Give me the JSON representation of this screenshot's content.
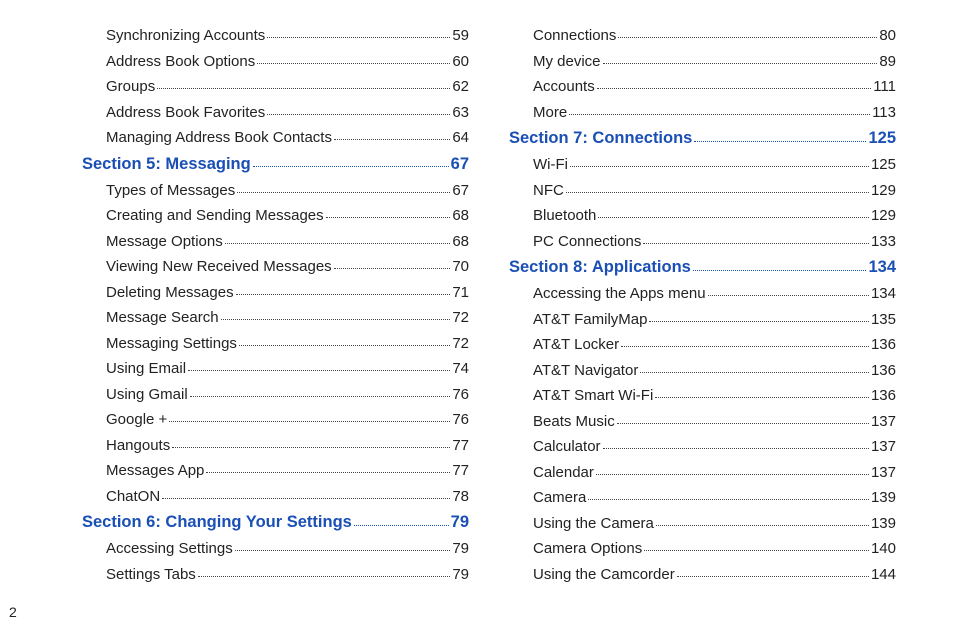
{
  "page_number": "2",
  "columns": [
    [
      {
        "type": "sub",
        "label": "Synchronizing Accounts ",
        "page": "59"
      },
      {
        "type": "sub",
        "label": "Address Book Options",
        "page": "60"
      },
      {
        "type": "sub",
        "label": "Groups ",
        "page": "62"
      },
      {
        "type": "sub",
        "label": "Address Book Favorites",
        "page": "63"
      },
      {
        "type": "sub",
        "label": "Managing Address Book Contacts",
        "page": "64"
      },
      {
        "type": "section",
        "label": "Section 5:  Messaging ",
        "page": "67"
      },
      {
        "type": "sub",
        "label": "Types of Messages",
        "page": "67"
      },
      {
        "type": "sub",
        "label": "Creating and Sending Messages",
        "page": "68"
      },
      {
        "type": "sub",
        "label": "Message Options",
        "page": "68"
      },
      {
        "type": "sub",
        "label": "Viewing New Received Messages",
        "page": "70"
      },
      {
        "type": "sub",
        "label": "Deleting Messages ",
        "page": "71"
      },
      {
        "type": "sub",
        "label": "Message Search",
        "page": "72"
      },
      {
        "type": "sub",
        "label": "Messaging Settings",
        "page": "72"
      },
      {
        "type": "sub",
        "label": "Using Email",
        "page": "74"
      },
      {
        "type": "sub",
        "label": "Using Gmail",
        "page": "76"
      },
      {
        "type": "sub",
        "label": "Google +",
        "page": "76"
      },
      {
        "type": "sub",
        "label": "Hangouts",
        "page": "77"
      },
      {
        "type": "sub",
        "label": "Messages App",
        "page": "77"
      },
      {
        "type": "sub",
        "label": "ChatON",
        "page": "78"
      },
      {
        "type": "section",
        "label": "Section 6:  Changing Your Settings ",
        "page": "79"
      },
      {
        "type": "sub",
        "label": "Accessing Settings",
        "page": "79"
      },
      {
        "type": "sub",
        "label": "Settings Tabs ",
        "page": "79"
      }
    ],
    [
      {
        "type": "sub",
        "label": "Connections ",
        "page": "80"
      },
      {
        "type": "sub",
        "label": "My device",
        "page": "89"
      },
      {
        "type": "sub",
        "label": "Accounts",
        "page": "111"
      },
      {
        "type": "sub",
        "label": "More",
        "page": " 113"
      },
      {
        "type": "section",
        "label": "Section 7:  Connections ",
        "page": "125"
      },
      {
        "type": "sub",
        "label": "Wi-Fi",
        "page": "125"
      },
      {
        "type": "sub",
        "label": "NFC",
        "page": "129"
      },
      {
        "type": "sub",
        "label": "Bluetooth",
        "page": "129"
      },
      {
        "type": "sub",
        "label": "PC Connections",
        "page": "133"
      },
      {
        "type": "section",
        "label": "Section 8:  Applications ",
        "page": "134"
      },
      {
        "type": "sub",
        "label": "Accessing the Apps menu",
        "page": "134"
      },
      {
        "type": "sub",
        "label": "AT&T FamilyMap",
        "page": "135"
      },
      {
        "type": "sub",
        "label": "AT&T Locker",
        "page": "136"
      },
      {
        "type": "sub",
        "label": "AT&T Navigator",
        "page": "136"
      },
      {
        "type": "sub",
        "label": "AT&T Smart Wi-Fi",
        "page": "136"
      },
      {
        "type": "sub",
        "label": "Beats Music",
        "page": "137"
      },
      {
        "type": "sub",
        "label": "Calculator ",
        "page": "137"
      },
      {
        "type": "sub",
        "label": "Calendar",
        "page": "137"
      },
      {
        "type": "sub",
        "label": "Camera",
        "page": "139"
      },
      {
        "type": "sub",
        "label": "Using the Camera ",
        "page": "139"
      },
      {
        "type": "sub",
        "label": "Camera Options",
        "page": "140"
      },
      {
        "type": "sub",
        "label": "Using the Camcorder",
        "page": "144"
      }
    ]
  ]
}
